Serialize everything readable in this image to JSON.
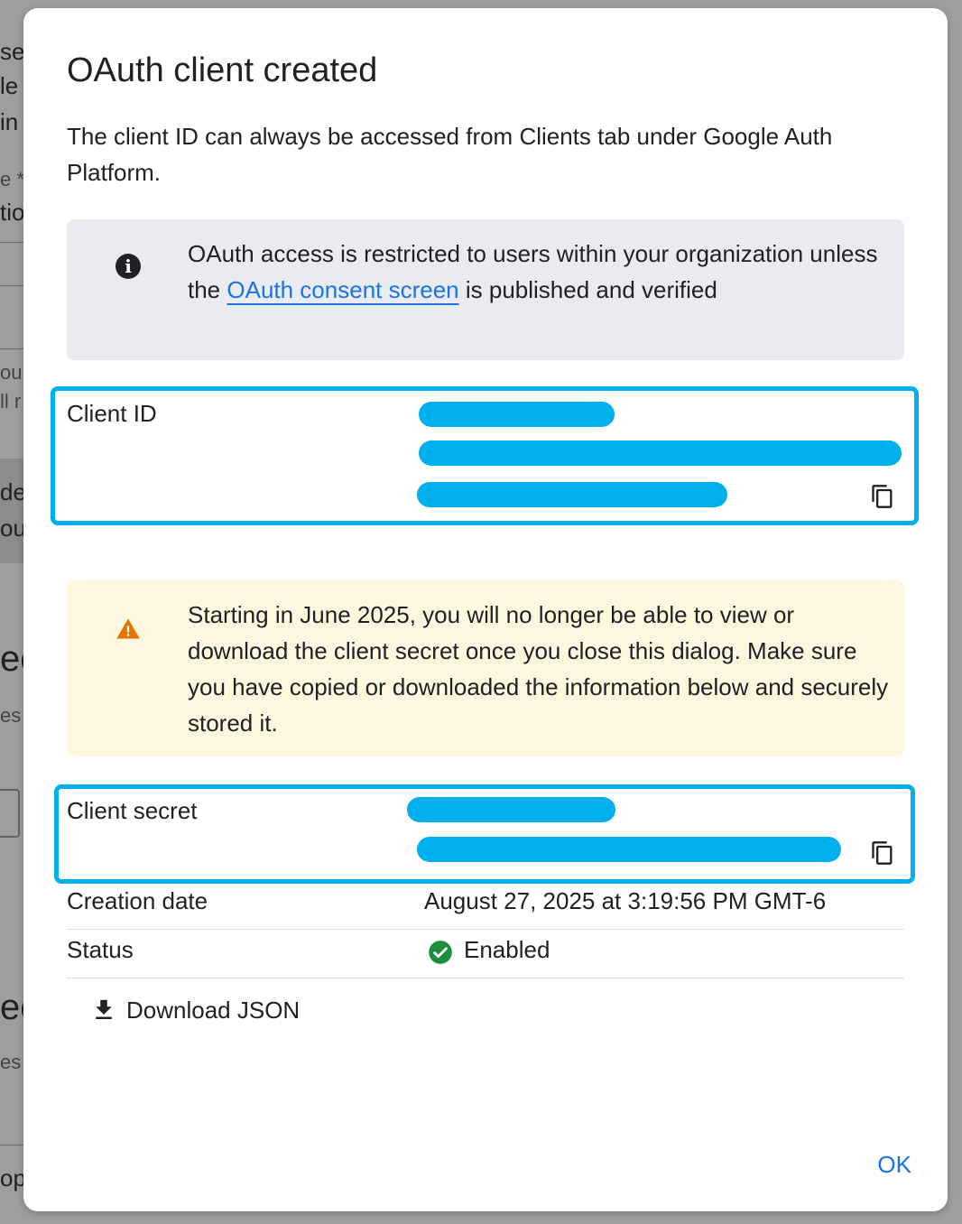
{
  "background_fragments": [
    "se",
    "le",
    "in",
    "e *",
    "tio",
    "our",
    "ll r",
    "de",
    "ou",
    "ec",
    "es",
    "ec",
    "es",
    "op."
  ],
  "dialog": {
    "title": "OAuth client created",
    "description": "The client ID can always be accessed from Clients tab under Google Auth Platform.",
    "info": {
      "text_before": "OAuth access is restricted to users within your organization unless the ",
      "link_text": "OAuth consent screen",
      "text_after": " is published and verified"
    },
    "client_id": {
      "label": "Client ID"
    },
    "warning": {
      "text": "Starting in June 2025, you will no longer be able to view or download the client secret once you close this dialog. Make sure you have copied or downloaded the information below and securely stored it."
    },
    "client_secret": {
      "label": "Client secret"
    },
    "details": [
      {
        "label": "Creation date",
        "value": "August 27, 2025 at 3:19:56 PM GMT-6"
      },
      {
        "label": "Status",
        "value": "Enabled"
      }
    ],
    "download_label": "Download JSON",
    "ok_label": "OK"
  },
  "colors": {
    "accent": "#1a73e8",
    "redaction": "#00b0ee",
    "warning_icon": "#e37400",
    "success_icon": "#1e8e3e",
    "info_bg": "#eaebee",
    "warning_bg": "#fef7e0"
  },
  "icons": [
    "info-icon",
    "copy-icon",
    "warning-icon",
    "check-circle-icon",
    "download-icon"
  ]
}
